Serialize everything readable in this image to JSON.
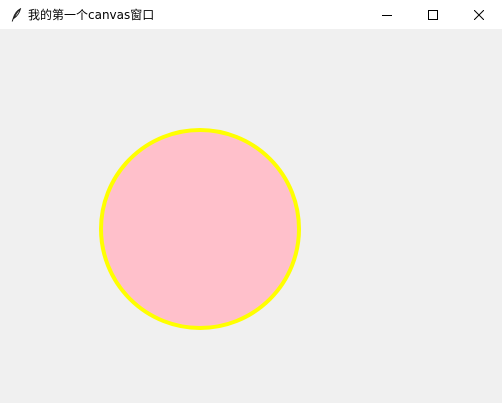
{
  "window": {
    "title": "我的第一个canvas窗口",
    "app_icon": "feather-icon",
    "controls": {
      "minimize_icon": "minimize-icon",
      "maximize_icon": "maximize-icon",
      "close_icon": "close-icon"
    }
  },
  "canvas": {
    "background_color": "#f0f0f0",
    "shapes": [
      {
        "type": "circle",
        "fill_color": "#ffc0cb",
        "outline_color": "#ffff00"
      }
    ]
  }
}
